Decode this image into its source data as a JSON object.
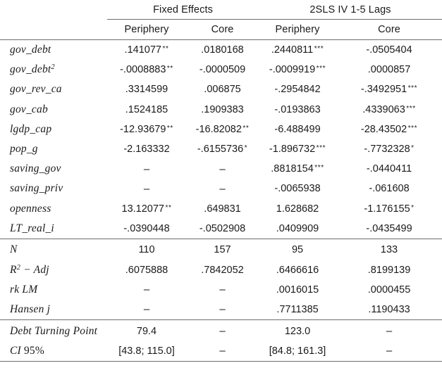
{
  "table": {
    "groups": [
      {
        "label": "",
        "span": 1
      },
      {
        "label": "Fixed Effects",
        "span": 2
      },
      {
        "label": "2SLS IV 1-5 Lags",
        "span": 2
      }
    ],
    "columns": [
      {
        "label": ""
      },
      {
        "label": "Periphery"
      },
      {
        "label": "Core"
      },
      {
        "label": "Periphery"
      },
      {
        "label": "Core"
      }
    ],
    "sections": [
      {
        "name": "coefficients",
        "rows": [
          {
            "label": "gov_debt",
            "label_sup": "",
            "cells": [
              {
                "value": ".141077",
                "stars": "**"
              },
              {
                "value": ".0180168",
                "stars": ""
              },
              {
                "value": ".2440811",
                "stars": "***"
              },
              {
                "value": "-.0505404",
                "stars": ""
              }
            ]
          },
          {
            "label": "gov_debt",
            "label_sup": "2",
            "cells": [
              {
                "value": "-.0008883",
                "stars": "**"
              },
              {
                "value": "-.0000509",
                "stars": ""
              },
              {
                "value": "-.0009919",
                "stars": "***"
              },
              {
                "value": ".0000857",
                "stars": ""
              }
            ]
          },
          {
            "label": "gov_rev_ca",
            "label_sup": "",
            "cells": [
              {
                "value": ".3314599",
                "stars": ""
              },
              {
                "value": ".006875",
                "stars": ""
              },
              {
                "value": "-.2954842",
                "stars": ""
              },
              {
                "value": "-.3492951",
                "stars": "***"
              }
            ]
          },
          {
            "label": "gov_cab",
            "label_sup": "",
            "cells": [
              {
                "value": ".1524185",
                "stars": ""
              },
              {
                "value": ".1909383",
                "stars": ""
              },
              {
                "value": "-.0193863",
                "stars": ""
              },
              {
                "value": ".4339063",
                "stars": "***"
              }
            ]
          },
          {
            "label": "lgdp_cap",
            "label_sup": "",
            "cells": [
              {
                "value": "-12.93679",
                "stars": "**"
              },
              {
                "value": "-16.82082",
                "stars": "**"
              },
              {
                "value": "-6.488499",
                "stars": ""
              },
              {
                "value": "-28.43502",
                "stars": "***"
              }
            ]
          },
          {
            "label": "pop_g",
            "label_sup": "",
            "cells": [
              {
                "value": "-2.163332",
                "stars": ""
              },
              {
                "value": "-.6155736",
                "stars": "*"
              },
              {
                "value": "-1.896732",
                "stars": "***"
              },
              {
                "value": "-.7732328",
                "stars": "*"
              }
            ]
          },
          {
            "label": "saving_gov",
            "label_sup": "",
            "cells": [
              {
                "value": "–",
                "stars": ""
              },
              {
                "value": "–",
                "stars": ""
              },
              {
                "value": ".8818154",
                "stars": "***"
              },
              {
                "value": "-.0440411",
                "stars": ""
              }
            ]
          },
          {
            "label": "saving_priv",
            "label_sup": "",
            "cells": [
              {
                "value": "–",
                "stars": ""
              },
              {
                "value": "–",
                "stars": ""
              },
              {
                "value": "-.0065938",
                "stars": ""
              },
              {
                "value": "-.061608",
                "stars": ""
              }
            ]
          },
          {
            "label": "openness",
            "label_sup": "",
            "cells": [
              {
                "value": "13.12077",
                "stars": "**"
              },
              {
                "value": ".649831",
                "stars": ""
              },
              {
                "value": "1.628682",
                "stars": ""
              },
              {
                "value": "-1.176155",
                "stars": "*"
              }
            ]
          },
          {
            "label": "LT_real_i",
            "label_sup": "",
            "cells": [
              {
                "value": "-.0390448",
                "stars": ""
              },
              {
                "value": "-.0502908",
                "stars": ""
              },
              {
                "value": ".0409909",
                "stars": ""
              },
              {
                "value": "-.0435499",
                "stars": ""
              }
            ]
          }
        ]
      },
      {
        "name": "diagnostics",
        "rows": [
          {
            "label": "N",
            "label_sup": "",
            "cells": [
              {
                "value": "110",
                "stars": ""
              },
              {
                "value": "157",
                "stars": ""
              },
              {
                "value": "95",
                "stars": ""
              },
              {
                "value": "133",
                "stars": ""
              }
            ]
          },
          {
            "label": "R",
            "label_sup": "2",
            "label_tail": " − Adj",
            "cells": [
              {
                "value": ".6075888",
                "stars": ""
              },
              {
                "value": ".7842052",
                "stars": ""
              },
              {
                "value": ".6466616",
                "stars": ""
              },
              {
                "value": ".8199139",
                "stars": ""
              }
            ]
          },
          {
            "label": "rk LM",
            "label_sup": "",
            "cells": [
              {
                "value": "–",
                "stars": ""
              },
              {
                "value": "–",
                "stars": ""
              },
              {
                "value": ".0016015",
                "stars": ""
              },
              {
                "value": ".0000455",
                "stars": ""
              }
            ]
          },
          {
            "label": "Hansen j",
            "label_sup": "",
            "cells": [
              {
                "value": "–",
                "stars": ""
              },
              {
                "value": "–",
                "stars": ""
              },
              {
                "value": ".7711385",
                "stars": ""
              },
              {
                "value": ".1190433",
                "stars": ""
              }
            ]
          }
        ]
      },
      {
        "name": "turning-point",
        "rows": [
          {
            "label": "Debt Turning Point",
            "label_sup": "",
            "cells": [
              {
                "value": "79.4",
                "stars": ""
              },
              {
                "value": "–",
                "stars": ""
              },
              {
                "value": "123.0",
                "stars": ""
              },
              {
                "value": "–",
                "stars": ""
              }
            ]
          },
          {
            "label": "CI ",
            "label_sup": "",
            "label_upright": "95%",
            "cells": [
              {
                "value": "[43.8; 115.0]",
                "stars": ""
              },
              {
                "value": "–",
                "stars": ""
              },
              {
                "value": "[84.8; 161.3]",
                "stars": ""
              },
              {
                "value": "–",
                "stars": ""
              }
            ]
          }
        ]
      }
    ]
  }
}
